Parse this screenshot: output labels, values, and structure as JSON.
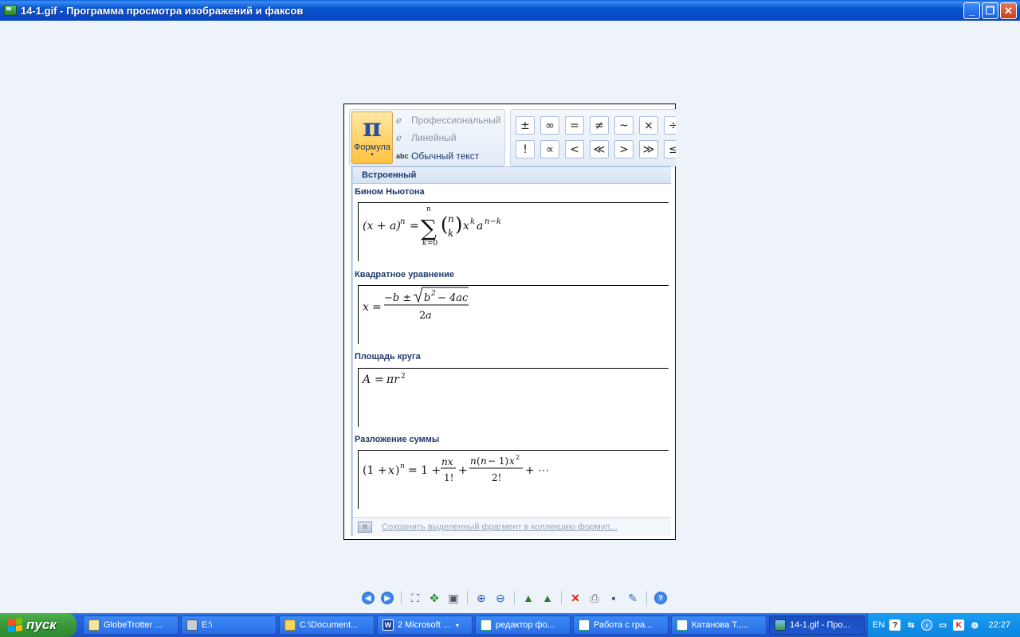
{
  "window": {
    "title": "14-1.gif - Программа просмотра изображений и факсов",
    "minimize_label": "_",
    "restore_label": "❐",
    "close_label": "✕"
  },
  "ribbon": {
    "formula_button_symbol": "π",
    "formula_button_label": "Формула",
    "formula_button_arrow": "▾",
    "modes": [
      {
        "icon": "e",
        "label": "Профессиональный"
      },
      {
        "icon": "e",
        "label": "Линейный"
      },
      {
        "icon": "abc",
        "label": "Обычный текст"
      }
    ],
    "symbols_row1": [
      "±",
      "∞",
      "=",
      "≠",
      "~",
      "×",
      "÷"
    ],
    "symbols_row2": [
      "!",
      "∝",
      "<",
      "≪",
      ">",
      "≫",
      "≤"
    ]
  },
  "gallery": {
    "header": "Встроенный",
    "items": [
      {
        "title": "Бином Ньютона"
      },
      {
        "title": "Квадратное уравнение"
      },
      {
        "title": "Площадь круга"
      },
      {
        "title": "Разложение суммы"
      }
    ],
    "footer_label": "Сохранить выделенный фрагмент в коллекцию формул..."
  },
  "toolbar": {
    "icons": [
      "prev-image-icon",
      "next-image-icon",
      "best-fit-icon",
      "actual-size-icon",
      "slideshow-icon",
      "zoom-in-icon",
      "zoom-out-icon",
      "rotate-clockwise-icon",
      "rotate-counterclockwise-icon",
      "delete-icon",
      "print-icon",
      "save-icon",
      "edit-icon",
      "help-icon"
    ]
  },
  "taskbar": {
    "start_label": "пуск",
    "tasks": [
      {
        "label": "GlobeTrotter ...",
        "icon": "globetrotter-icon"
      },
      {
        "label": "E:\\",
        "icon": "drive-icon"
      },
      {
        "label": "C:\\Document...",
        "icon": "folder-icon"
      },
      {
        "label": "2 Microsoft ...",
        "icon": "word-icon"
      },
      {
        "label": "редактор фо...",
        "icon": "ie-icon"
      },
      {
        "label": "Работа с гра...",
        "icon": "ie-icon"
      },
      {
        "label": "Катанова Т.,...",
        "icon": "ie-icon"
      },
      {
        "label": "14-1.gif - Про...",
        "icon": "image-viewer-icon",
        "active": true
      }
    ],
    "language": "EN",
    "clock": "22:27"
  }
}
